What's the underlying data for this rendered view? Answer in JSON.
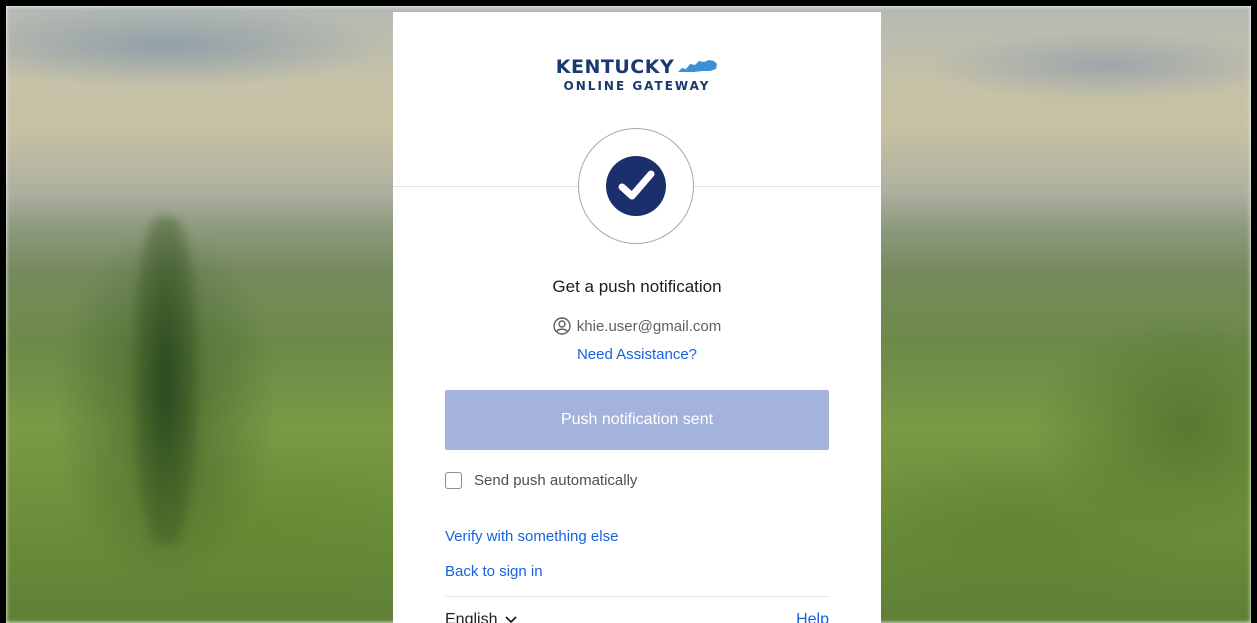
{
  "logo": {
    "line1": "KENTUCKY",
    "line2": "ONLINE GATEWAY"
  },
  "badge": {
    "icon": "okta-verify-check-icon",
    "color": "#1a2f6b"
  },
  "heading": "Get a push notification",
  "identifier": {
    "icon": "user-circle-icon",
    "email": "khie.user@gmail.com"
  },
  "assistance_link": "Need Assistance?",
  "push_button": {
    "label": "Push notification sent",
    "color": "#a3b3db"
  },
  "auto_push": {
    "label": "Send push automatically",
    "checked": false
  },
  "links": {
    "verify_other": "Verify with something else",
    "back_to_signin": "Back to sign in"
  },
  "footer": {
    "language": "English",
    "language_icon": "chevron-down-icon",
    "help": "Help"
  },
  "colors": {
    "link": "#1662dd",
    "brand": "#1a3a6e"
  }
}
